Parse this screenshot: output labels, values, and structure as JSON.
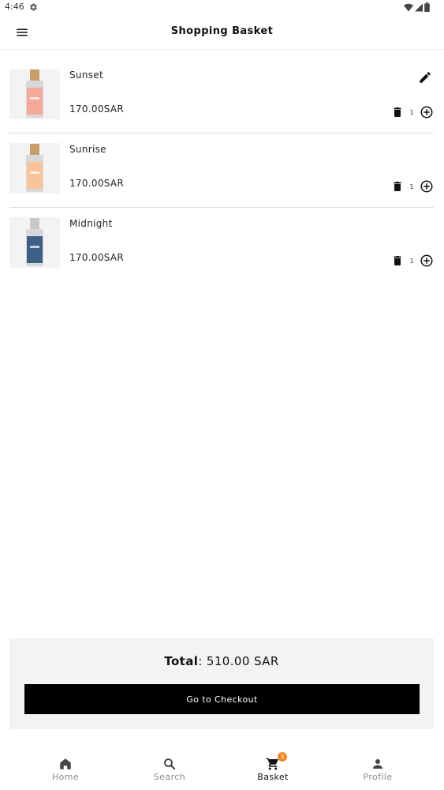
{
  "status_bar": {
    "time": "4:46",
    "icons": [
      "gear-icon",
      "wifi-icon",
      "signal-icon",
      "battery-icon"
    ]
  },
  "app_bar": {
    "title": "Shopping Basket",
    "menu_icon": "menu-icon"
  },
  "basket": {
    "items": [
      {
        "name": "Sunset",
        "price": "170.00SAR",
        "quantity": "1",
        "bottle_color": "#f4a89a"
      },
      {
        "name": "Sunrise",
        "price": "170.00SAR",
        "quantity": "1",
        "bottle_color": "#f9c49a"
      },
      {
        "name": "Midnight",
        "price": "170.00SAR",
        "quantity": "1",
        "bottle_color": "#3e5f86"
      }
    ]
  },
  "total": {
    "label": "Total",
    "value": "510.00 SAR"
  },
  "checkout": {
    "label": "Go to Checkout"
  },
  "bottom_nav": {
    "items": [
      {
        "label": "Home",
        "icon": "home-icon",
        "active": false
      },
      {
        "label": "Search",
        "icon": "search-icon",
        "active": false
      },
      {
        "label": "Basket",
        "icon": "cart-icon",
        "active": true,
        "badge": "3"
      },
      {
        "label": "Profile",
        "icon": "person-icon",
        "active": false
      }
    ]
  },
  "colors": {
    "accent": "#000000",
    "badge": "#f08a24",
    "panel": "#f4f3f4"
  }
}
